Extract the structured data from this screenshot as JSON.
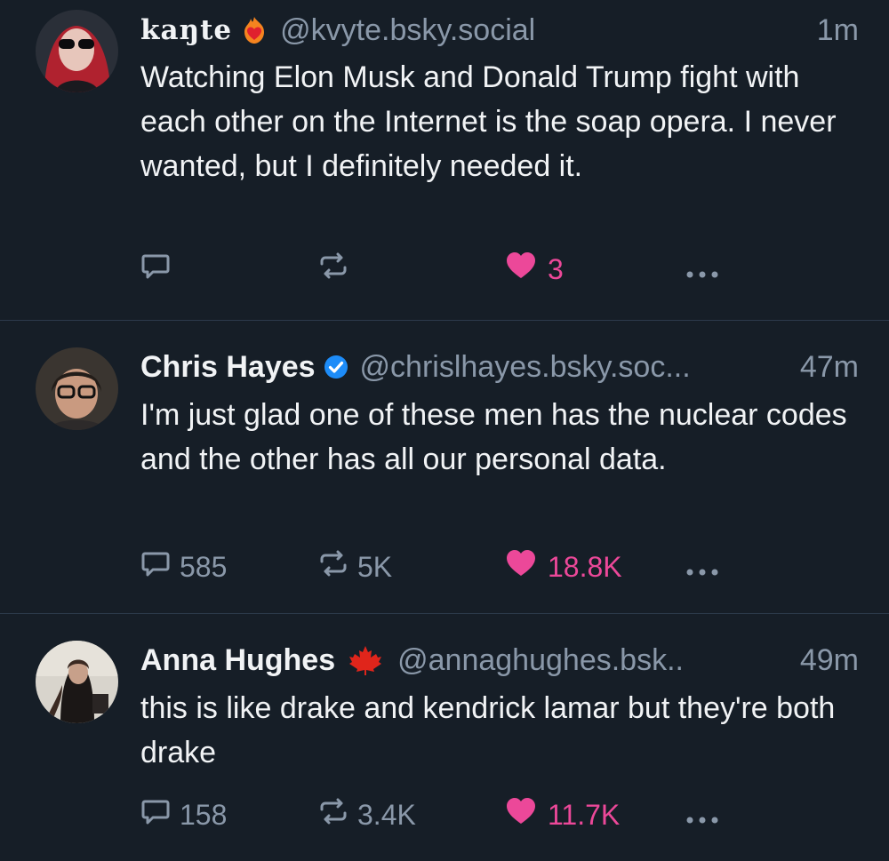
{
  "colors": {
    "background": "#161e27",
    "text": "#f1f3f5",
    "muted": "#8a98a9",
    "like": "#ec4899",
    "verified": "#1d8cf8",
    "divider": "#2c3a4b"
  },
  "posts": [
    {
      "author": "kaŋte",
      "author_badge_icon": "heart-on-fire-icon",
      "handle": "@kvyte.bsky.social",
      "time": "1m",
      "text": "Watching Elon Musk and Donald Trump fight with each other on the Internet is the soap opera. I never wanted, but I definitely needed it.",
      "replies": "",
      "reposts": "",
      "likes": "3"
    },
    {
      "author": "Chris Hayes",
      "author_badge_icon": "verified-check-icon",
      "handle": "@chrislhayes.bsky.soc...",
      "time": "47m",
      "text": "I'm just glad one of these men has the nuclear codes and the other has all our personal data.",
      "replies": "585",
      "reposts": "5K",
      "likes": "18.8K"
    },
    {
      "author": "Anna Hughes",
      "author_badge_icon": "maple-leaf-icon",
      "handle": "@annaghughes.bsk..",
      "time": "49m",
      "text": "this is like drake and kendrick lamar but they're both drake",
      "replies": "158",
      "reposts": "3.4K",
      "likes": "11.7K"
    }
  ]
}
